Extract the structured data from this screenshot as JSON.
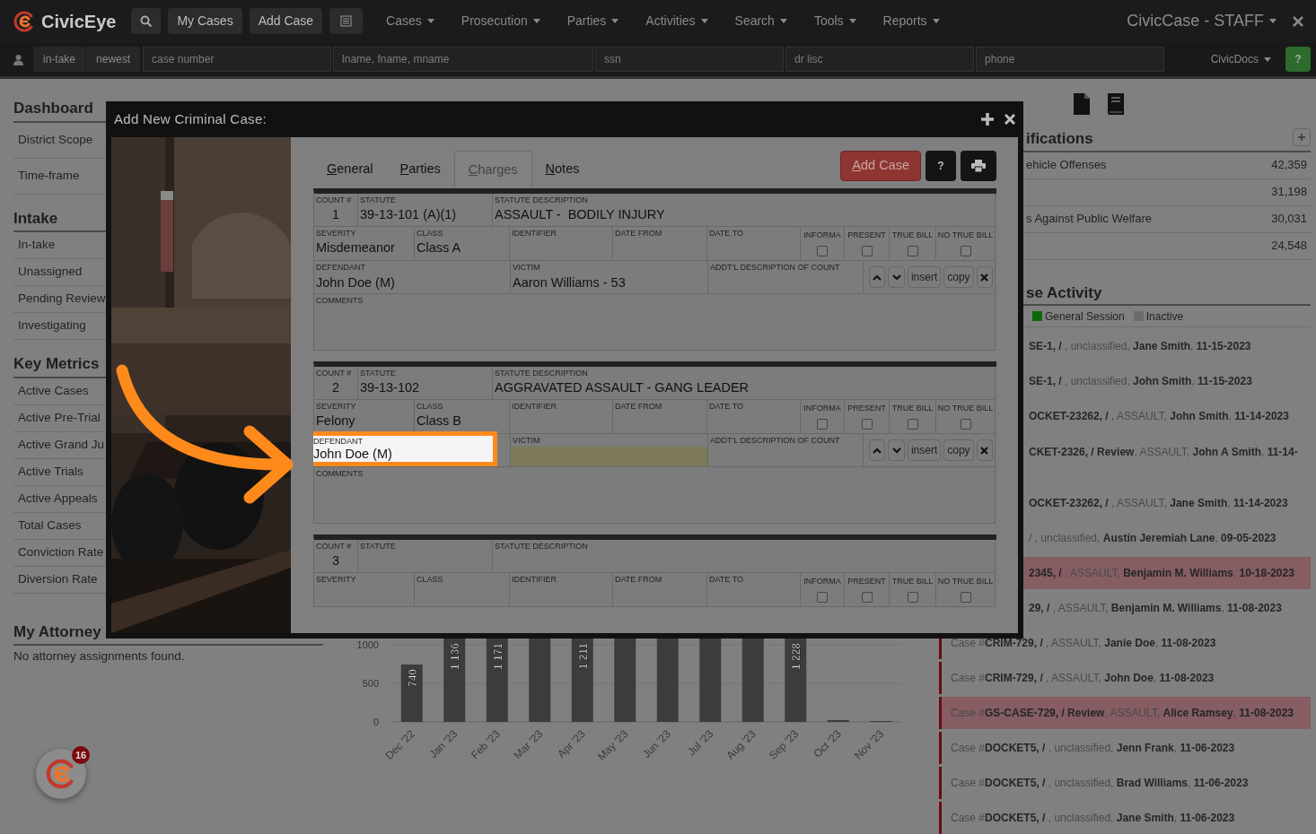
{
  "top_bar": {
    "logo": "CivicEye",
    "buttons": [
      "My Cases",
      "Add Case"
    ],
    "menus": [
      "Cases",
      "Prosecution",
      "Parties",
      "Activities",
      "Search",
      "Tools",
      "Reports"
    ],
    "app_title": "CivicCase - STAFF"
  },
  "search_bar": {
    "filters": [
      "in-take",
      "newest"
    ],
    "fields": [
      {
        "placeholder": "case number"
      },
      {
        "placeholder": "lname, fname, mname"
      },
      {
        "placeholder": "ssn"
      },
      {
        "placeholder": "dr lisc"
      },
      {
        "placeholder": "phone"
      }
    ],
    "docs_menu": "CivicDocs",
    "help": "?"
  },
  "sidebar": {
    "sections": [
      {
        "title": "Dashboard",
        "items": [
          "District Scope",
          "Time-frame"
        ]
      },
      {
        "title": "Intake",
        "items": [
          "In-take",
          "Unassigned",
          "Pending Review",
          "Investigating"
        ]
      },
      {
        "title": "Key Metrics",
        "items": [
          "Active Cases",
          "Active Pre-Trial",
          "Active Grand Ju",
          "Active Trials",
          "Active Appeals",
          "Total Cases",
          "Conviction Rate",
          "Diversion Rate"
        ]
      },
      {
        "title": "My Attorney",
        "note": "No attorney assignments found."
      }
    ]
  },
  "chart": {
    "y_ticks": [
      "1000",
      "500",
      "0"
    ],
    "bars": [
      {
        "category": "Dec '22",
        "label": "740"
      },
      {
        "category": "Jan '23",
        "label": "1 136"
      },
      {
        "category": "Feb '23",
        "label": "1 171"
      },
      {
        "category": "Mar '23"
      },
      {
        "category": "Apr '23",
        "label": "1 211"
      },
      {
        "category": "May '23"
      },
      {
        "category": "Jun '23"
      },
      {
        "category": "Jul '23"
      },
      {
        "category": "Aug '23"
      },
      {
        "category": "Sep '23",
        "label": "1 228"
      },
      {
        "category": "Oct '23"
      },
      {
        "category": "Nov '23"
      }
    ]
  },
  "right_panel": {
    "classifications": {
      "title": "ifications",
      "rows": [
        {
          "label": "ehicle Offenses",
          "count": "42,359"
        },
        {
          "count": "31,198"
        },
        {
          "label": "s Against Public Welfare",
          "count": "30,031"
        },
        {
          "count": "24,548"
        }
      ]
    },
    "activity": {
      "title": "se Activity",
      "legend": [
        {
          "label": "General Session",
          "color": "#0b690b"
        },
        {
          "label": "Inactive",
          "color": "#6c6c6c"
        }
      ],
      "rows": [
        {
          "text": "**SE-1, /** , unclassified, **Jane Smith**, **11-15-2023**",
          "flagged": false
        },
        {
          "text": "**SE-1, /** , unclassified, **John Smith**, **11-15-2023**",
          "flagged": false
        },
        {
          "text": "**OCKET-23262, /** , ASSAULT, **John Smith**, **11-14-2023**",
          "flagged": false
        },
        {
          "text": "**CKET-2326, / Review**, ASSAULT, **John A Smith**, **11-14-**",
          "flagged": false
        },
        {
          "text": "**OCKET-23262, /** , ASSAULT, **Jane Smith**, **11-14-2023**",
          "flagged": false
        },
        {
          "text": "/ , unclassified, **Austin Jeremiah Lane**, **09-05-2023**",
          "flagged": false
        },
        {
          "text": "**2345, /** , ASSAULT, **Benjamin M. Williams**, **10-18-2023**",
          "flagged": true
        },
        {
          "text": "**29, /** , ASSAULT, **Benjamin M. Williams**, **11-08-2023**",
          "flagged": false
        },
        {
          "text": "Case #**CRIM-729, /** , ASSAULT, **Janie Doe**, **11-08-2023**",
          "flagged": false
        },
        {
          "text": "Case #**CRIM-729, /** , ASSAULT, **John Doe**, **11-08-2023**",
          "flagged": false
        },
        {
          "text": "Case #**GS-CASE-729, / Review**, ASSAULT, **Alice Ramsey**, **11-08-2023**",
          "flagged": true
        },
        {
          "text": "Case #**DOCKET5, /** , unclassified, **Jenn Frank**, **11-06-2023**",
          "flagged": false
        },
        {
          "text": "Case #**DOCKET5, /** , unclassified, **Brad Williams**, **11-06-2023**",
          "flagged": false
        },
        {
          "text": "Case #**DOCKET5, /** , unclassified, **Jane Smith**, **11-06-2023**",
          "flagged": false
        }
      ]
    }
  },
  "notification_badge": "16",
  "modal": {
    "title": "Add New Criminal Case:",
    "tabs": [
      {
        "label": "General",
        "selected": false
      },
      {
        "label": "Parties",
        "selected": false
      },
      {
        "label": "Charges",
        "selected": true
      },
      {
        "label": "Notes",
        "selected": false
      }
    ],
    "add_button": "Add Case",
    "help_button": "?",
    "charges": [
      {
        "fields": [
          {
            "kind": "text",
            "label": "COUNT #",
            "value": "1"
          },
          {
            "kind": "text",
            "label": "STATUTE",
            "value": "39-13-101 (A)(1)"
          },
          {
            "kind": "text",
            "label": "STATUTE DESCRIPTION",
            "value": "ASSAULT -  BODILY INJURY"
          },
          {
            "kind": "text",
            "label": "SEVERITY",
            "value": "Misdemeanor"
          },
          {
            "kind": "text",
            "label": "CLASS",
            "value": "Class A"
          },
          {
            "kind": "text",
            "label": "IDENTIFIER"
          },
          {
            "kind": "text",
            "label": "DATE FROM"
          },
          {
            "kind": "text",
            "label": "DATE TO"
          },
          {
            "kind": "check",
            "label": "INFORMA",
            "checked": false
          },
          {
            "kind": "check",
            "label": "PRESENT",
            "checked": false
          },
          {
            "kind": "check",
            "label": "TRUE BILL",
            "checked": false
          },
          {
            "kind": "check",
            "label": "NO TRUE BILL",
            "checked": false
          },
          {
            "kind": "text",
            "label": "DEFENDANT",
            "value": "John Doe (M)",
            "spotlight": false,
            "missing": false
          },
          {
            "kind": "text",
            "label": "VICTIM",
            "value": "Aaron Williams - 53",
            "spotlight": false,
            "missing": false
          },
          {
            "kind": "text",
            "label": "ADDT'L DESCRIPTION OF COUNT",
            "spotlight": false,
            "missing": false
          },
          {
            "kind": "actions",
            "buttons": [
              "insert",
              "copy"
            ]
          },
          {
            "kind": "area",
            "label": "COMMENTS"
          }
        ]
      },
      {
        "fields": [
          {
            "kind": "text",
            "label": "COUNT #",
            "value": "2"
          },
          {
            "kind": "text",
            "label": "STATUTE",
            "value": "39-13-102"
          },
          {
            "kind": "text",
            "label": "STATUTE DESCRIPTION",
            "value": "AGGRAVATED ASSAULT - GANG LEADER"
          },
          {
            "kind": "text",
            "label": "SEVERITY",
            "value": "Felony"
          },
          {
            "kind": "text",
            "label": "CLASS",
            "value": "Class B"
          },
          {
            "kind": "text",
            "label": "IDENTIFIER"
          },
          {
            "kind": "text",
            "label": "DATE FROM"
          },
          {
            "kind": "text",
            "label": "DATE TO"
          },
          {
            "kind": "check",
            "label": "INFORMA",
            "checked": false
          },
          {
            "kind": "check",
            "label": "PRESENT",
            "checked": false
          },
          {
            "kind": "check",
            "label": "TRUE BILL",
            "checked": false
          },
          {
            "kind": "check",
            "label": "NO TRUE BILL",
            "checked": false
          },
          {
            "kind": "text",
            "label": "DEFENDANT",
            "value": "John Doe (M)",
            "spotlight": true,
            "missing": false
          },
          {
            "kind": "text",
            "label": "VICTIM",
            "spotlight": false,
            "missing": true
          },
          {
            "kind": "text",
            "label": "ADDT'L DESCRIPTION OF COUNT",
            "spotlight": false,
            "missing": false
          },
          {
            "kind": "actions",
            "buttons": [
              "insert",
              "copy"
            ]
          },
          {
            "kind": "area",
            "label": "COMMENTS"
          }
        ]
      },
      {
        "fields": [
          {
            "kind": "text",
            "label": "COUNT #",
            "value": "3"
          },
          {
            "kind": "text",
            "label": "STATUTE"
          },
          {
            "kind": "text",
            "label": "STATUTE DESCRIPTION"
          },
          {
            "kind": "text",
            "label": "SEVERITY"
          },
          {
            "kind": "text",
            "label": "CLASS"
          },
          {
            "kind": "text",
            "label": "IDENTIFIER"
          },
          {
            "kind": "text",
            "label": "DATE FROM"
          },
          {
            "kind": "text",
            "label": "DATE TO"
          },
          {
            "kind": "check",
            "label": "INFORMA",
            "checked": false
          },
          {
            "kind": "check",
            "label": "PRESENT",
            "checked": false
          },
          {
            "kind": "check",
            "label": "TRUE BILL",
            "checked": false
          },
          {
            "kind": "check",
            "label": "NO TRUE BILL",
            "checked": false
          }
        ]
      }
    ]
  }
}
